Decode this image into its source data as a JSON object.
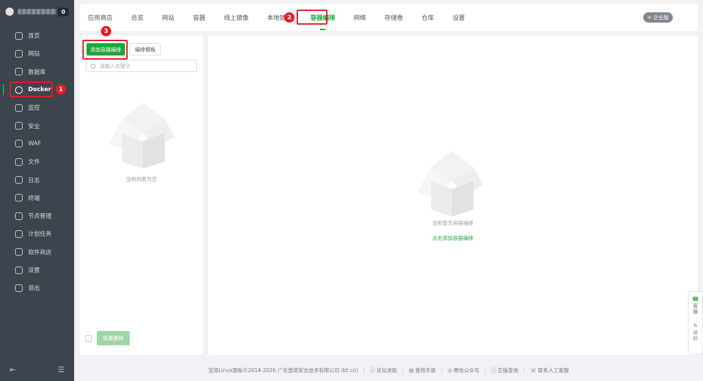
{
  "sidebar": {
    "badge": "0",
    "items": [
      {
        "label": "首页",
        "icon": "home-icon"
      },
      {
        "label": "网站",
        "icon": "globe-icon"
      },
      {
        "label": "数据库",
        "icon": "database-icon"
      },
      {
        "label": "Docker",
        "icon": "docker-icon"
      },
      {
        "label": "监控",
        "icon": "monitor-icon"
      },
      {
        "label": "安全",
        "icon": "shield-icon"
      },
      {
        "label": "WAF",
        "icon": "waf-icon"
      },
      {
        "label": "文件",
        "icon": "folder-icon"
      },
      {
        "label": "日志",
        "icon": "log-icon"
      },
      {
        "label": "终端",
        "icon": "terminal-icon"
      },
      {
        "label": "节点管理",
        "icon": "node-icon"
      },
      {
        "label": "计划任务",
        "icon": "calendar-icon"
      },
      {
        "label": "软件商店",
        "icon": "store-icon"
      },
      {
        "label": "设置",
        "icon": "gear-icon"
      },
      {
        "label": "退出",
        "icon": "logout-icon"
      }
    ]
  },
  "tabs": [
    "应用商店",
    "总览",
    "网站",
    "容器",
    "线上镜像",
    "本地镜像",
    "容器编排",
    "网络",
    "存储卷",
    "仓库",
    "设置"
  ],
  "enterprise": "企业版",
  "left": {
    "add_btn": "添加容器编排",
    "tpl_btn": "编排模板",
    "search_placeholder": "请输入关键字",
    "empty": "当前列表为空",
    "bulk_btn": "批量删除"
  },
  "right": {
    "empty": "当前暂无容器编排",
    "link": "点击添加容器编排"
  },
  "float": {
    "service": "客服",
    "review": "评价"
  },
  "steps": [
    "1",
    "2",
    "3"
  ],
  "footer": {
    "copyright": "宝塔Linux面板©2014-2026 广东堡塔安全技术有限公司 (bt.cn)",
    "links": [
      "论坛求助",
      "使用手册",
      "微信公众号",
      "正版查询",
      "联系人工客服"
    ]
  },
  "colors": {
    "accent": "#20a53a",
    "sidebar": "#3c444d",
    "highlight": "#e51c23"
  }
}
